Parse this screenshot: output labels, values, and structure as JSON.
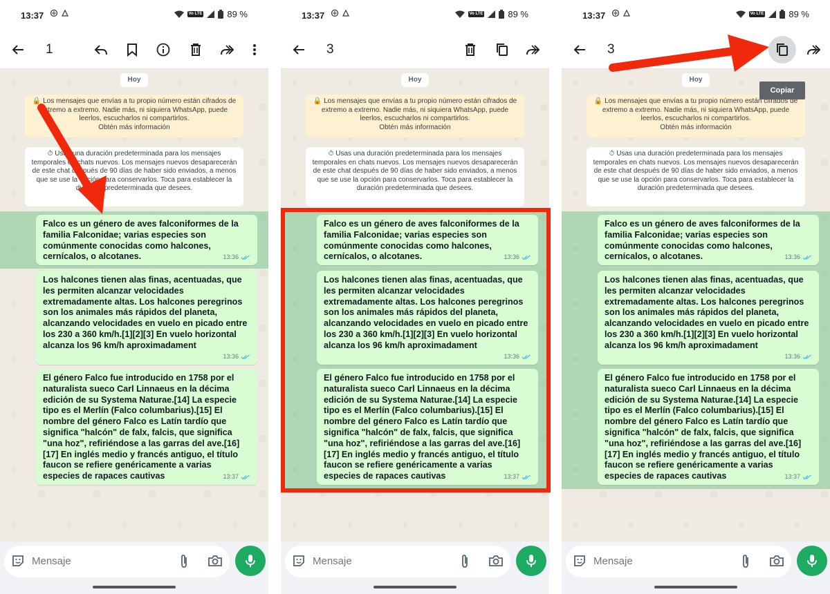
{
  "status": {
    "time": "13:37",
    "battery": "89 %",
    "volte": "Vo LTE"
  },
  "toolbar_1": {
    "count": "1"
  },
  "toolbar_2": {
    "count": "3"
  },
  "toolbar_3": {
    "count": "3"
  },
  "chat": {
    "date_chip": "Hoy",
    "encryption_notice": "Los mensajes que envías a tu propio número están cifrados de extremo a extremo. Nadie más, ni siquiera WhatsApp, puede leerlos, escucharlos ni compartirlos.",
    "encryption_link": "Obtén más información",
    "duration_notice": "Usas una duración predeterminada para los mensajes temporales en chats nuevos. Los mensajes nuevos desaparecerán de este chat después de 90 días de haber sido enviados, a menos que se use la opción para conservarlos. Toca para establecer la duración predeterminada que desees.",
    "messages": [
      {
        "text": "Falco es un género de aves falconiformes de la familia Falconidae; varias especies son comúnmente conocidas como halcones, cernícalos, o alcotanes.",
        "time": "13:36"
      },
      {
        "text": "Los halcones tienen alas finas, acentuadas, que les permiten alcanzar velocidades extremadamente altas. Los halcones peregrinos son los animales más rápidos del planeta, alcanzando velocidades en vuelo en picado entre los 230 a 360 km/h.[1][2][3] En vuelo horizontal alcanza los 96 km/h aproximadament",
        "time": "13:36"
      },
      {
        "text": "El género Falco fue introducido en 1758 por el naturalista sueco Carl Linnaeus en la décima edición de su Systema Naturae.[14] La especie tipo es el Merlín (Falco columbarius).[15] El nombre del género Falco es Latín tardío que significa \"halcón\" de falx, falcis, que significa \"una hoz\", refiriéndose a las garras del ave.[16][17] En inglés medio y francés antiguo, el título faucon se refiere genéricamente a varias especies de rapaces cautivas",
        "time": "13:37"
      }
    ]
  },
  "input": {
    "placeholder": "Mensaje"
  },
  "tooltip": {
    "copy_label": "Copiar"
  },
  "colors": {
    "accent": "#1daa61",
    "selection": "#56bd78",
    "annotation_red": "#f1290c",
    "bubble": "#d9fdd3"
  },
  "icons": [
    "back-arrow-icon",
    "reply-icon",
    "bookmark-icon",
    "info-icon",
    "delete-icon",
    "copy-icon",
    "forward-icon",
    "more-icon",
    "sticker-icon",
    "attach-icon",
    "camera-icon",
    "mic-icon",
    "check-double-icon",
    "lock-icon",
    "timer-icon",
    "wifi-icon",
    "signal-icon",
    "battery-icon"
  ]
}
